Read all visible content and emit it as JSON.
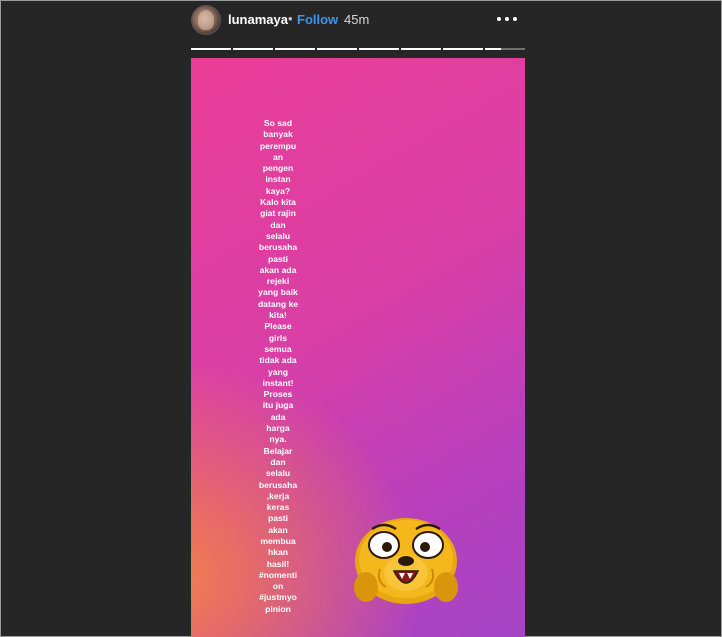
{
  "header": {
    "username": "lunamaya",
    "separator": "•",
    "follow_label": "Follow",
    "time": "45m"
  },
  "progress": {
    "segments": [
      1,
      1,
      1,
      1,
      1,
      1,
      1,
      0.4
    ]
  },
  "story": {
    "caption": "So sad\nbanyak\nperempu\nan\npengen\ninstan\nkaya?\nKalo kita\ngiat rajin\ndan\nselalu\nberusaha\npasti\nakan ada\nrejeki\nyang baik\ndatang ke\nkita!\nPlease\ngirls\nsemua\ntidak ada\nyang\ninstant!\nProses\nitu juga\nada\nharga\nnya.\nBelajar\ndan\nselalu\nberusaha\n,kerja\nkeras\npasti\nakan\nmembua\nhkan\nhasil!\n#nomenti\non\n#justmyo\npinion",
    "sticker_icon": "jake-the-dog-sticker",
    "gradient_colors": [
      "#ea3d97",
      "#a545c6",
      "#f2824a"
    ]
  }
}
